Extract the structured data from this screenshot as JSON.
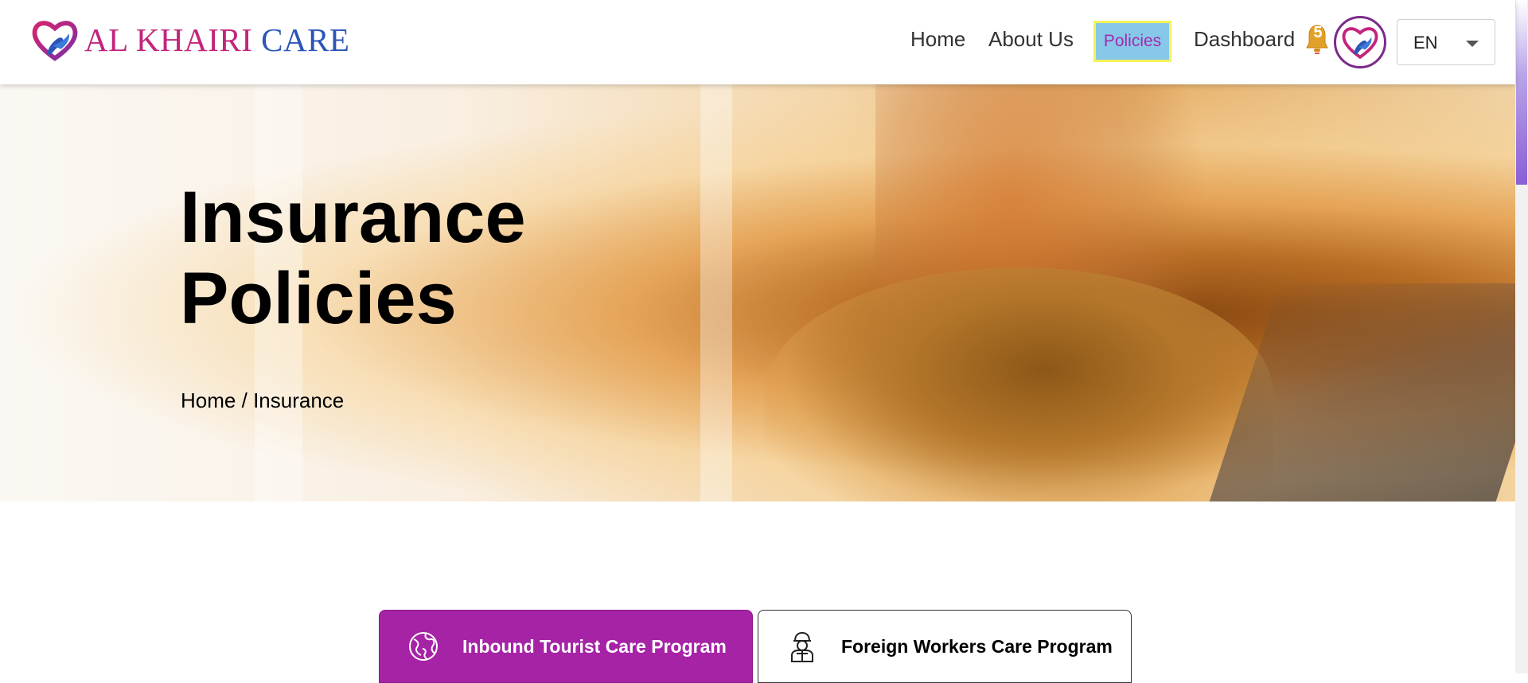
{
  "brand": {
    "name_part1": "AL KHAIRI",
    "name_part2": "CARE",
    "colors": {
      "magenta": "#c2257c",
      "blue": "#2b56b8"
    }
  },
  "nav": {
    "items": [
      {
        "label": "Home"
      },
      {
        "label": "About Us"
      },
      {
        "label": "Policies",
        "active": true
      },
      {
        "label": "Dashboard"
      }
    ],
    "notification_count": "5",
    "language": "EN"
  },
  "hero": {
    "title": "Insurance\nPolicies",
    "breadcrumb": {
      "home": "Home",
      "separator": "/",
      "current": "Insurance"
    }
  },
  "tabs": [
    {
      "label": "Inbound Tourist Care Program",
      "icon": "globe-icon",
      "active": true
    },
    {
      "label": "Foreign Workers Care Program",
      "icon": "worker-icon",
      "active": false
    }
  ],
  "colors": {
    "accent": "#a623a6",
    "active_nav_bg": "#87c8e8",
    "active_nav_border": "#f5f25a"
  }
}
